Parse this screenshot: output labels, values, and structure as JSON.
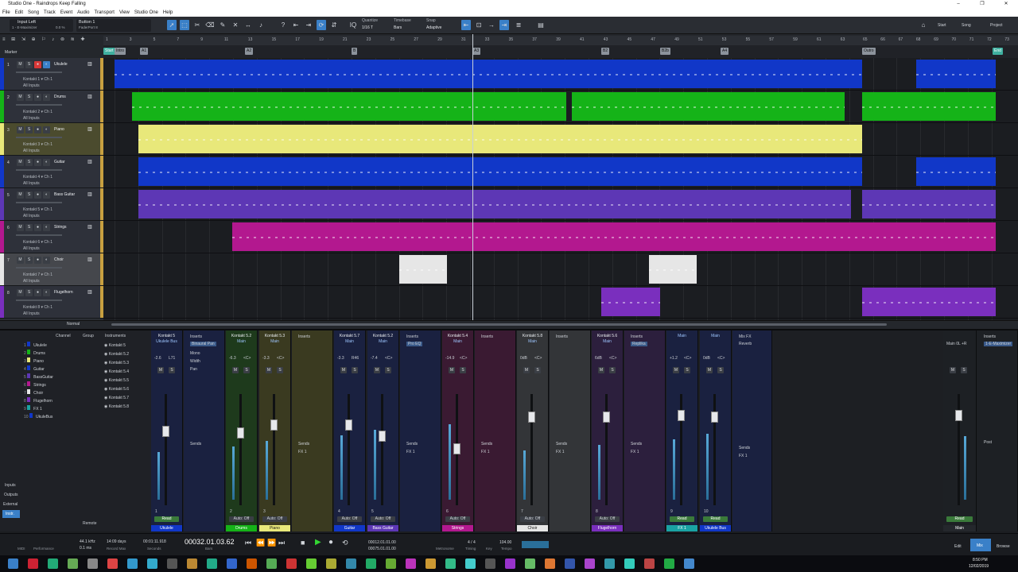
{
  "window": {
    "title": "Studio One - Raindrops Keep Falling",
    "controls": [
      "–",
      "❐",
      "✕"
    ]
  },
  "menu": [
    "File",
    "Edit",
    "Song",
    "Track",
    "Event",
    "Audio",
    "Transport",
    "View",
    "Studio One",
    "Help"
  ],
  "toolbar": {
    "input_label": "Input Left",
    "input_sub": "1 - E-Maximizer",
    "input_val": "0.0 %",
    "button_label": "Button 1",
    "button_sub": "FaderPort 8",
    "quantize_label": "Quantize",
    "quantize_value": "1/16 T",
    "timebase_label": "Timebase",
    "timebase_value": "Bars",
    "snap_label": "Snap",
    "snap_value": "Adaptive",
    "right_tabs": [
      "Start",
      "Song",
      "Project"
    ]
  },
  "ruler": {
    "ticks": [
      "1",
      "3",
      "5",
      "7",
      "9",
      "11",
      "13",
      "15",
      "17",
      "19",
      "21",
      "23",
      "25",
      "27",
      "29",
      "31",
      "33",
      "35",
      "37",
      "39",
      "41",
      "43",
      "45",
      "47",
      "49",
      "51",
      "53",
      "55",
      "57",
      "59",
      "61",
      "63",
      "65",
      "66",
      "67",
      "68",
      "69",
      "70",
      "71",
      "72",
      "73"
    ],
    "markers": [
      "Start",
      "Intro",
      "A1",
      "A2",
      "B",
      "A3",
      "B2",
      "B2b",
      "A4",
      "Outro",
      "End"
    ]
  },
  "marker_label": "Marker",
  "tracks": [
    {
      "num": "1",
      "name": "Ukulele",
      "inst": "Kontakt 1",
      "ch": "Ch 1",
      "input": "All Inputs",
      "color": "#1137c8",
      "side": "#c8a040"
    },
    {
      "num": "2",
      "name": "Drums",
      "inst": "Kontakt 2",
      "ch": "Ch 1",
      "input": "All Inputs",
      "color": "#15b318",
      "side": "#c8a040"
    },
    {
      "num": "3",
      "name": "Piano",
      "inst": "Kontakt 3",
      "ch": "Ch 1",
      "input": "All Inputs",
      "color": "#e8e87a",
      "side": "#c8a040"
    },
    {
      "num": "4",
      "name": "Guitar",
      "inst": "Kontakt 4",
      "ch": "Ch 1",
      "input": "All Inputs",
      "color": "#1137c8",
      "side": "#c8a040"
    },
    {
      "num": "5",
      "name": "Bass Guitar",
      "inst": "Kontakt 5",
      "ch": "Ch 1",
      "input": "All Inputs",
      "color": "#5d37b5",
      "side": "#c8a040"
    },
    {
      "num": "6",
      "name": "Strings",
      "inst": "Kontakt 6",
      "ch": "Ch 1",
      "input": "All Inputs",
      "color": "#b3188f",
      "side": "#c8a040"
    },
    {
      "num": "7",
      "name": "Choir",
      "inst": "Kontakt 7",
      "ch": "Ch 1",
      "input": "All Inputs",
      "color": "#e6e6e6",
      "side": "#c8a040"
    },
    {
      "num": "8",
      "name": "Flugelhorn",
      "inst": "Kontakt 8",
      "ch": "Ch 1",
      "input": "All Inputs",
      "color": "#7a2fbe",
      "side": "#c8a040"
    }
  ],
  "timeline_bottom": {
    "zoom": "Normal"
  },
  "channel_list": {
    "headers": [
      "Channel",
      "Group",
      "Instruments"
    ],
    "channels": [
      "Ukulele",
      "Drums",
      "Piano",
      "Guitar",
      "BassGuitar",
      "Strings",
      "Choir",
      "Flugelhorn",
      "FX 1",
      "UkuleBus"
    ],
    "instruments": [
      "Kontakt 5",
      "Kontakt 5.2",
      "Kontakt 5.3",
      "Kontakt 5.4",
      "Kontakt 5.5",
      "Kontakt 5.6",
      "Kontakt 5.7",
      "Kontakt 5.8"
    ],
    "side_buttons": [
      "Inputs",
      "Outputs",
      "External",
      "Instr.",
      "Remote"
    ]
  },
  "mixer": {
    "strips": [
      {
        "top": "Kontakt 5",
        "sub": "Ukulele Bus",
        "vol": "-2.6",
        "pan": "L71",
        "num": "1",
        "name": "Ukulele",
        "color": "#1137c8",
        "auto": "Read"
      },
      {
        "top": "Kontakt 5.2",
        "sub": "Main",
        "vol": "-6.3",
        "pan": "<C>",
        "num": "2",
        "name": "Drums",
        "color": "#15b318",
        "auto": "Auto: Off"
      },
      {
        "top": "Kontakt 5.3",
        "sub": "Main",
        "vol": "-3.3",
        "pan": "<C>",
        "num": "3",
        "name": "Piano",
        "color": "#e8e87a",
        "auto": "Auto: Off"
      },
      {
        "top": "Kontakt 5.7",
        "sub": "Main",
        "vol": "-3.3",
        "pan": "R46",
        "num": "4",
        "name": "Guitar",
        "color": "#1137c8",
        "auto": "Auto: Off"
      },
      {
        "top": "Kontakt 5.2",
        "sub": "Main",
        "vol": "-7.4",
        "pan": "<C>",
        "num": "5",
        "name": "Bass Guitar",
        "color": "#5d37b5",
        "auto": "Auto: Off"
      },
      {
        "top": "Kontakt 5.4",
        "sub": "Main",
        "vol": "-14.9",
        "pan": "<C>",
        "num": "6",
        "name": "Strings",
        "color": "#b3188f",
        "auto": "Auto: Off"
      },
      {
        "top": "Kontakt 5.8",
        "sub": "Main",
        "vol": "0dB",
        "pan": "<C>",
        "num": "7",
        "name": "Choir",
        "color": "#e6e6e6",
        "auto": "Auto: Off"
      },
      {
        "top": "Kontakt 5.6",
        "sub": "Main",
        "vol": "6dB",
        "pan": "<C>",
        "num": "8",
        "name": "Flugelhorn",
        "color": "#7a2fbe",
        "auto": "Auto: Off"
      },
      {
        "top": "",
        "sub": "Main",
        "vol": "+1.2",
        "pan": "<C>",
        "num": "9",
        "name": "FX 1",
        "color": "#1aa3a3",
        "auto": "Read"
      },
      {
        "top": "",
        "sub": "Main",
        "vol": "0dB",
        "pan": "<C>",
        "num": "10",
        "name": "Ukulele Bus",
        "color": "#1137c8",
        "auto": "Read"
      }
    ],
    "inserts_label": "Inserts",
    "sends_label": "Sends",
    "fx_label": "FX 1",
    "insert_items": [
      "Binaural Pan",
      "Pro EQ",
      "Replika"
    ],
    "mono": "Mono",
    "width": "Width",
    "pan": "Pan",
    "mix_fx": "Mix FX",
    "mix_fx_item": "Reverb",
    "main": {
      "top": "Main 0L +R",
      "inserts": "Inserts",
      "insert_item": "1-E-Maximizer",
      "post": "Post",
      "auto": "Read",
      "name": "Main"
    }
  },
  "transport": {
    "sample_rate": "44.1 kHz",
    "latency": "0.1 ms",
    "record_max": "14:09 days",
    "record_max_label": "Record Max",
    "seconds": "00:01:11.918",
    "seconds_label": "Seconds",
    "bars": "00032.01.03.62",
    "bars_label": "Bars",
    "loop_start": "00012.01.01.00",
    "loop_end": "00075.01.01.00",
    "time_sig": "4 / 4",
    "tempo": "104.00",
    "labels": [
      "MIDI",
      "Performance",
      "Metronome",
      "Timing",
      "Key",
      "Tempo"
    ],
    "tabs": [
      "Edit",
      "Mix",
      "Browse"
    ]
  },
  "taskbar": {
    "time": "8:50 PM",
    "date": "12/02/2019"
  }
}
